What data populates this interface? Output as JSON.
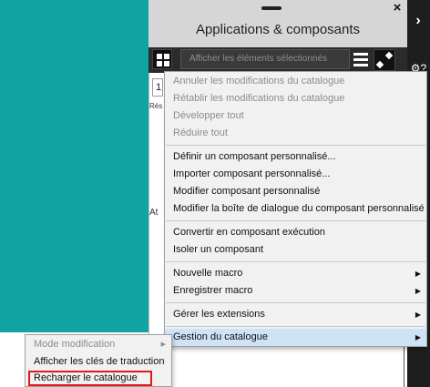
{
  "panel": {
    "title": "Applications & composants",
    "close_glyph": "×",
    "search_placeholder": "Afficher les éléments sélectionnés"
  },
  "right_strip": {
    "chevron": "›",
    "help": "⚙?",
    "gear": "✱"
  },
  "background": {
    "field_value": "1",
    "label_res": "Rés",
    "label_at": "At"
  },
  "main_menu": {
    "items": [
      {
        "label": "Annuler les modifications du catalogue",
        "enabled": false
      },
      {
        "label": "Rétablir les modifications du catalogue",
        "enabled": false
      },
      {
        "label": "Développer tout",
        "enabled": false
      },
      {
        "label": "Réduire tout",
        "enabled": false
      },
      {
        "label": "Définir un composant personnalisé...",
        "enabled": true
      },
      {
        "label": "Importer composant personnalisé...",
        "enabled": true
      },
      {
        "label": "Modifier composant personnalisé",
        "enabled": true
      },
      {
        "label": "Modifier la boîte de dialogue du composant personnalisé",
        "enabled": true
      },
      {
        "label": "Convertir en composant exécution",
        "enabled": true
      },
      {
        "label": "Isoler un composant",
        "enabled": true
      },
      {
        "label": "Nouvelle macro",
        "enabled": true,
        "submenu": true
      },
      {
        "label": "Enregistrer macro",
        "enabled": true,
        "submenu": true
      },
      {
        "label": "Gérer les extensions",
        "enabled": true,
        "submenu": true
      },
      {
        "label": "Gestion du catalogue",
        "enabled": true,
        "submenu": true,
        "highlighted": true
      }
    ],
    "submenu_arrow": "▶"
  },
  "sub_menu": {
    "items": [
      {
        "label": "Mode modification",
        "enabled": false,
        "submenu": true
      },
      {
        "label": "Afficher les clés de traduction",
        "enabled": true
      },
      {
        "label": "Recharger le catalogue",
        "enabled": true,
        "boxed": true
      }
    ]
  },
  "colors": {
    "teal": "#0fa3a1",
    "highlight": "#cfe3f7",
    "callout_red": "#e01818",
    "accent_orange": "#e87d1e"
  }
}
